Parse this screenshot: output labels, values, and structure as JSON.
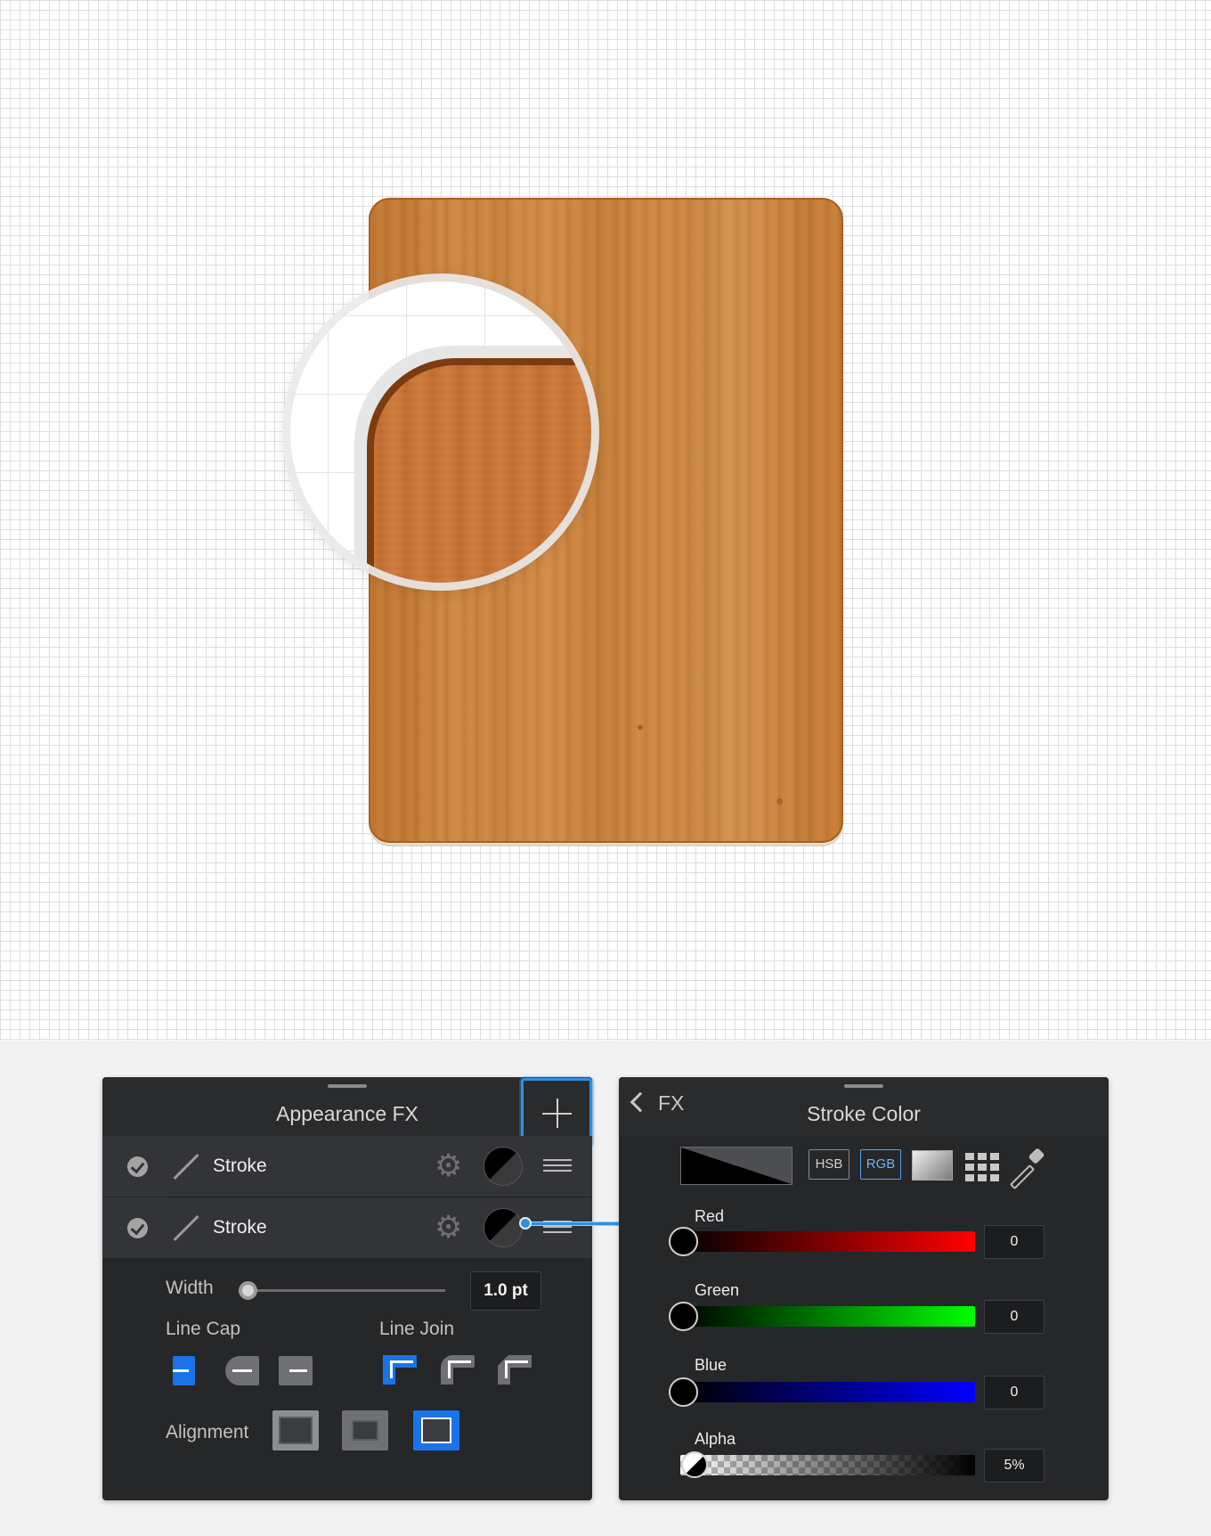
{
  "appearance_panel": {
    "title": "Appearance FX",
    "rows": [
      {
        "label": "Stroke"
      },
      {
        "label": "Stroke"
      }
    ],
    "width_label": "Width",
    "width_value": "1.0 pt",
    "line_cap_label": "Line Cap",
    "line_join_label": "Line Join",
    "alignment_label": "Alignment"
  },
  "stroke_color_panel": {
    "back_label": "FX",
    "title": "Stroke Color",
    "modes": [
      "HSB",
      "RGB"
    ],
    "active_mode": "RGB",
    "channels": [
      {
        "label": "Red",
        "value": "0"
      },
      {
        "label": "Green",
        "value": "0"
      },
      {
        "label": "Blue",
        "value": "0"
      },
      {
        "label": "Alpha",
        "value": "5%"
      }
    ]
  },
  "colors": {
    "accent": "#2f8fe0",
    "panel_bg": "#262729",
    "wood": "#cf8a45"
  },
  "icons": [
    "plus-icon",
    "check-icon",
    "stroke-line-icon",
    "gear-icon",
    "menu-icon",
    "chevron-left-icon",
    "gradient-icon",
    "swatches-icon",
    "eyedropper-icon"
  ]
}
